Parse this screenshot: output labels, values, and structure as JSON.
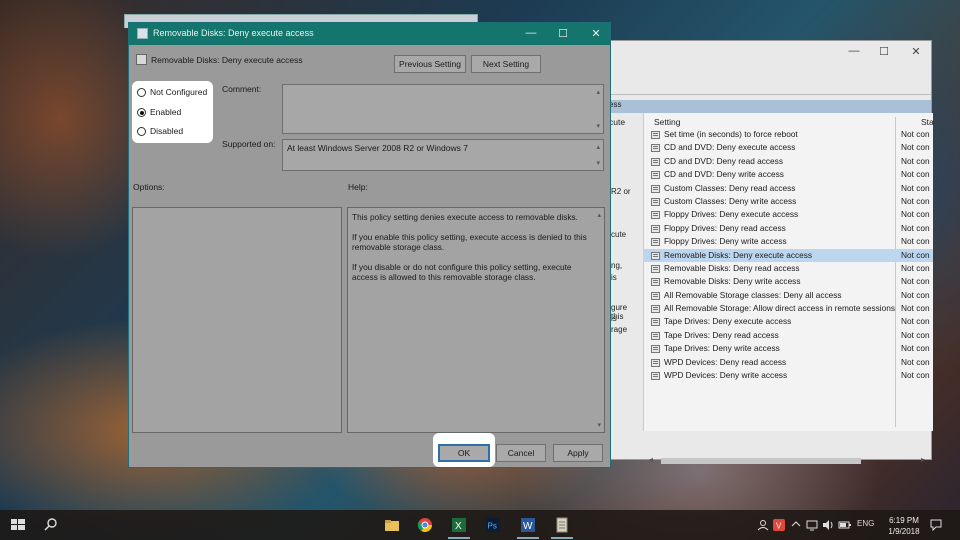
{
  "dialog": {
    "title": "Removable Disks: Deny execute access",
    "header": "Removable Disks: Deny execute access",
    "prev_button": "Previous Setting",
    "next_button": "Next Setting",
    "radio_not_configured": "Not Configured",
    "radio_enabled": "Enabled",
    "radio_disabled": "Disabled",
    "selected_option": "Enabled",
    "comment_label": "Comment:",
    "supported_label": "Supported on:",
    "supported_value": "At least Windows Server 2008 R2 or Windows 7",
    "options_label": "Options:",
    "help_label": "Help:",
    "help_p1": "This policy setting denies execute access to removable disks.",
    "help_p2": "If you enable this policy setting, execute access is denied to this removable storage class.",
    "help_p3": "If you disable or do not configure this policy setting, execute access is allowed to this removable storage class.",
    "ok_button": "OK",
    "cancel_button": "Cancel",
    "apply_button": "Apply"
  },
  "bg_window": {
    "band_text": "ess",
    "left_col_header": "cute",
    "left_fragments": [
      "R2 or",
      "cute",
      "ng,",
      "is",
      "gure this",
      "is",
      "rage"
    ],
    "col_setting": "Setting",
    "col_state": "Sta",
    "rows": [
      {
        "name": "Set time (in seconds) to force reboot",
        "state": "Not con"
      },
      {
        "name": "CD and DVD: Deny execute access",
        "state": "Not con"
      },
      {
        "name": "CD and DVD: Deny read access",
        "state": "Not con"
      },
      {
        "name": "CD and DVD: Deny write access",
        "state": "Not con"
      },
      {
        "name": "Custom Classes: Deny read access",
        "state": "Not con"
      },
      {
        "name": "Custom Classes: Deny write access",
        "state": "Not con"
      },
      {
        "name": "Floppy Drives: Deny execute access",
        "state": "Not con"
      },
      {
        "name": "Floppy Drives: Deny read access",
        "state": "Not con"
      },
      {
        "name": "Floppy Drives: Deny write access",
        "state": "Not con"
      },
      {
        "name": "Removable Disks: Deny execute access",
        "state": "Not con"
      },
      {
        "name": "Removable Disks: Deny read access",
        "state": "Not con"
      },
      {
        "name": "Removable Disks: Deny write access",
        "state": "Not con"
      },
      {
        "name": "All Removable Storage classes: Deny all access",
        "state": "Not con"
      },
      {
        "name": "All Removable Storage: Allow direct access in remote sessions",
        "state": "Not con"
      },
      {
        "name": "Tape Drives: Deny execute access",
        "state": "Not con"
      },
      {
        "name": "Tape Drives: Deny read access",
        "state": "Not con"
      },
      {
        "name": "Tape Drives: Deny write access",
        "state": "Not con"
      },
      {
        "name": "WPD Devices: Deny read access",
        "state": "Not con"
      },
      {
        "name": "WPD Devices: Deny write access",
        "state": "Not con"
      }
    ],
    "selected_row": 9
  },
  "taskbar": {
    "language": "ENG",
    "time": "6:19 PM",
    "date": "1/9/2018",
    "apps": [
      "file-explorer-icon",
      "chrome-icon",
      "excel-icon",
      "photoshop-icon",
      "word-icon",
      "policy-editor-icon"
    ]
  },
  "colors": {
    "titlebar": "#13756c",
    "highlight": "#ffffff",
    "selected_row": "#bcd6ef"
  }
}
